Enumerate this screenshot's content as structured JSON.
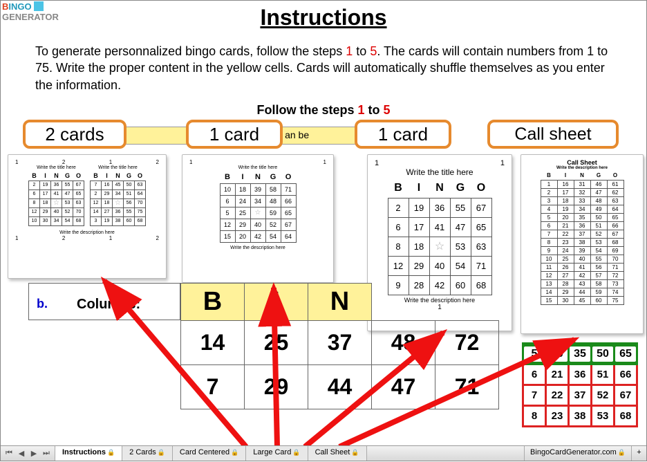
{
  "logo": {
    "text1": "BINGO",
    "text2": "GENERATOR"
  },
  "title": "Instructions",
  "intro_a": "To generate personnalized bingo cards, follow the steps ",
  "intro_b": " to ",
  "intro_c": ". The cards will contain numbers from 1 to 75. Write the proper content in the yellow cells. Cards will automatically shuffle themselves as you enter the information.",
  "step_one": "1",
  "step_five": "5",
  "follow_a": "Follow the steps ",
  "follow_b": " to ",
  "yellow_band": ". .. .  an be",
  "pills": {
    "p1": "2 cards",
    "p2": "1 card",
    "p3": "1 card",
    "p4": "Call sheet"
  },
  "mini_title": "Write the title here",
  "mini_desc": "Write the description here",
  "bingo_letters": [
    "B",
    "I",
    "N",
    "G",
    "O"
  ],
  "thumb1_left": [
    [
      "2",
      "19",
      "36",
      "55",
      "67"
    ],
    [
      "6",
      "17",
      "41",
      "47",
      "65"
    ],
    [
      "8",
      "18",
      "",
      "53",
      "63"
    ],
    [
      "12",
      "29",
      "40",
      "52",
      "70"
    ],
    [
      "10",
      "30",
      "34",
      "54",
      "68"
    ]
  ],
  "thumb1_right": [
    [
      "7",
      "16",
      "45",
      "50",
      "63"
    ],
    [
      "2",
      "29",
      "34",
      "51",
      "64"
    ],
    [
      "12",
      "18",
      "",
      "56",
      "70"
    ],
    [
      "14",
      "27",
      "36",
      "55",
      "75"
    ],
    [
      "3",
      "19",
      "38",
      "60",
      "68"
    ]
  ],
  "thumb2": [
    [
      "10",
      "18",
      "39",
      "58",
      "71"
    ],
    [
      "6",
      "24",
      "34",
      "48",
      "66"
    ],
    [
      "5",
      "25",
      "",
      "59",
      "65"
    ],
    [
      "12",
      "29",
      "40",
      "52",
      "67"
    ],
    [
      "15",
      "20",
      "42",
      "54",
      "64"
    ]
  ],
  "thumb3": [
    [
      "2",
      "19",
      "36",
      "55",
      "67"
    ],
    [
      "6",
      "17",
      "41",
      "47",
      "65"
    ],
    [
      "8",
      "18",
      "",
      "53",
      "63"
    ],
    [
      "12",
      "29",
      "40",
      "54",
      "71"
    ],
    [
      "9",
      "28",
      "42",
      "60",
      "68"
    ]
  ],
  "call_sheet_title": "Call Sheet",
  "call_sheet": [
    [
      "1",
      "16",
      "31",
      "46",
      "61"
    ],
    [
      "2",
      "17",
      "32",
      "47",
      "62"
    ],
    [
      "3",
      "18",
      "33",
      "48",
      "63"
    ],
    [
      "4",
      "19",
      "34",
      "49",
      "64"
    ],
    [
      "5",
      "20",
      "35",
      "50",
      "65"
    ],
    [
      "6",
      "21",
      "36",
      "51",
      "66"
    ],
    [
      "7",
      "22",
      "37",
      "52",
      "67"
    ],
    [
      "8",
      "23",
      "38",
      "53",
      "68"
    ],
    [
      "9",
      "24",
      "39",
      "54",
      "69"
    ],
    [
      "10",
      "25",
      "40",
      "55",
      "70"
    ],
    [
      "11",
      "26",
      "41",
      "56",
      "71"
    ],
    [
      "12",
      "27",
      "42",
      "57",
      "72"
    ],
    [
      "13",
      "28",
      "43",
      "58",
      "73"
    ],
    [
      "14",
      "29",
      "44",
      "59",
      "74"
    ],
    [
      "15",
      "30",
      "45",
      "60",
      "75"
    ]
  ],
  "columns_label_b": "b.",
  "columns_label": "Columns:",
  "big_header": [
    "B",
    "I",
    "N"
  ],
  "big_rows": [
    [
      "14",
      "25",
      "37",
      "48",
      "72"
    ],
    [
      "7",
      "29",
      "44",
      "47",
      "71"
    ]
  ],
  "side_header": [
    "5",
    "20",
    "35",
    "50",
    "65"
  ],
  "side_rows": [
    [
      "6",
      "21",
      "36",
      "51",
      "66"
    ],
    [
      "7",
      "22",
      "37",
      "52",
      "67"
    ],
    [
      "8",
      "23",
      "38",
      "53",
      "68"
    ]
  ],
  "tabs": {
    "t1": "Instructions",
    "t2": "2 Cards",
    "t3": "Card Centered",
    "t4": "Large Card",
    "t5": "Call Sheet",
    "url": "BingoCardGenerator.com"
  }
}
